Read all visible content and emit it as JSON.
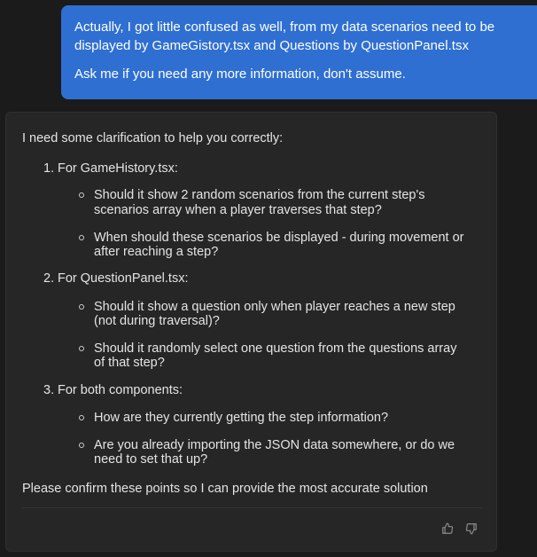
{
  "user_message": {
    "paragraphs": [
      "Actually, I got little confused as well, from my data scenarios need to be",
      "displayed by GameGistory.tsx and Questions by QuestionPanel.tsx",
      "Ask me if you need any more information, don't assume."
    ]
  },
  "assistant_message": {
    "intro": "I need some clarification to help you correctly:",
    "sections": [
      {
        "number": "1.",
        "title": "For GameHistory.tsx:",
        "bullets": [
          [
            "Should it show 2 random scenarios from the current step's",
            "scenarios array when a player traverses that step?"
          ],
          [
            "When should these scenarios be displayed - during movement or",
            "after reaching a step?"
          ]
        ]
      },
      {
        "number": "2.",
        "title": "For QuestionPanel.tsx:",
        "bullets": [
          [
            "Should it show a question only when player reaches a new step",
            "(not during traversal)?"
          ],
          [
            "Should it randomly select one question from the questions array",
            "of that step?"
          ]
        ]
      },
      {
        "number": "3.",
        "title": "For both components:",
        "bullets": [
          [
            "How are they currently getting the step information?"
          ],
          [
            "Are you already importing the JSON data somewhere, or do we",
            "need to set that up?"
          ]
        ]
      }
    ],
    "closing": "Please confirm these points so I can provide the most accurate solution"
  },
  "actions": {
    "thumbs_up_icon": "thumbs-up",
    "thumbs_down_icon": "thumbs-down"
  }
}
